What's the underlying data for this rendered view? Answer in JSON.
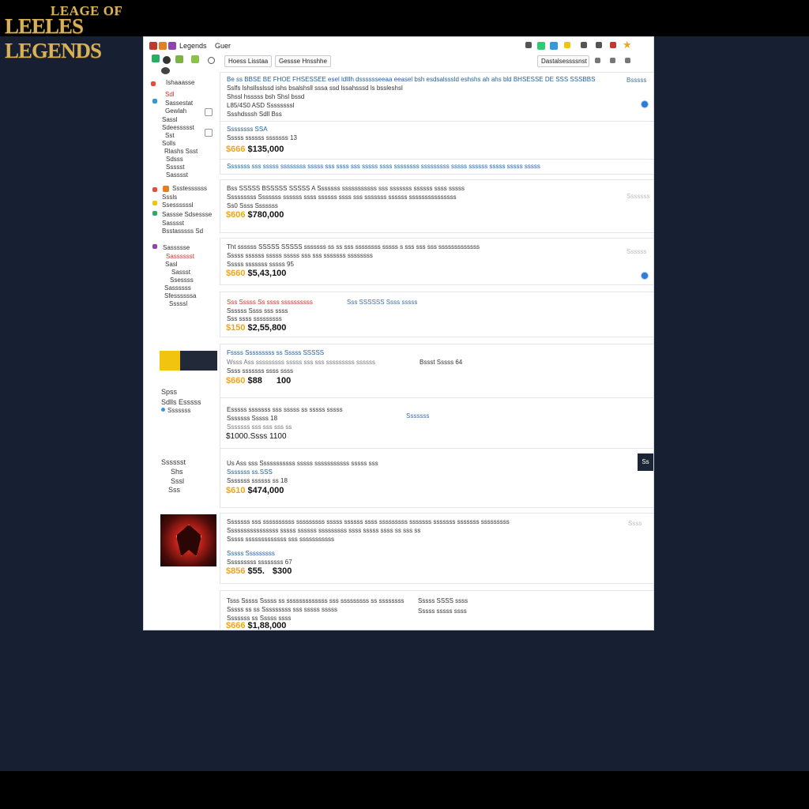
{
  "logo": {
    "line1": "LEAGE OF",
    "line2": "LEELES LEGENDS"
  },
  "toolbar": {
    "title_left": "Legends",
    "title_mid": "Guer",
    "btn_primary": "Hoess Lisstaa",
    "btn_secondary": "Gessse Hnsshhe",
    "dropdown": "Dastalsessssnst"
  },
  "sidebar": {
    "section1": [
      "Ishaaasse",
      "Sdl",
      "Sassestat",
      "Gewlah",
      "Sassl",
      "Sdeessssst",
      "Sst",
      "Solls",
      "Rlashs Ssst",
      "Sdsss",
      "Ssssst",
      "Sasssst"
    ],
    "section2": [
      "Ssstessssss",
      "Sssls",
      "Ssessssssl",
      "Sassse Sdsessse",
      "Sasssst",
      "Bsstasssss Sd"
    ],
    "section3": [
      "Sassssse",
      "Sasssssst",
      "Sasl",
      "Sassst",
      "Ssessss",
      "Sassssss",
      "Sfessssssa",
      "Sssssl"
    ],
    "section4_label1": "Spss",
    "section4_label2": "Sdlls Esssss",
    "section4_label3": "Sssssss",
    "section5_label1": "Sssssst",
    "section5_label2": "Shs",
    "section5_label3": "Sssl",
    "section5_label4": "Sss"
  },
  "listings": [
    {
      "line1": "Be ss BBSE BE FHOE FHSESSEE esel ldlllh dsssssseeaa eeasel bsh esdsalsssld eshshs ah ahs bld BHSESSE DE SSS SSSBBS",
      "line2": "Sslfs lshsllsslssd ishs bsalshsll sssa ssd lssahsssd ls bssleshsl",
      "line3": "Shssl hsssss bsh Shsl bssd",
      "line4": "L85/4S0 ASD Ssssssssl",
      "line5": "Ssshdsssh Sdll Bss",
      "right": "Bsssss"
    },
    {
      "line1": "Ssssssss SSA",
      "line2": "Sssss ssssss sssssss 13",
      "price_tag": "$666",
      "price": "$135,000"
    },
    {
      "line1": "Sssssss sss sssss ssssssss sssss sss ssss sss sssss ssss ssssssss sssssssss sssss ssssss sssss sssss sssss"
    },
    {
      "line1": "Bss SSSSS BSSSSS SSSSS A Sssssss sssssssssss sss sssssss ssssss ssss sssss",
      "line2": "Sssssssss Sssssss ssssss ssss ssssss ssss sss sssssss ssssss sssssssssssssss",
      "line3": "Ss0 Ssss Sssssss",
      "price_tag": "$606",
      "price": "$780,000",
      "right": "Sssssss"
    },
    {
      "line1": "Tht ssssss SSSSS SSSSS sssssss ss ss sss ssssssss sssss s sss sss sss sssssssssssss",
      "line2": "Sssss ssssss sssss sssss sss sss sssssss ssssssss",
      "line3": "Sssss sssssss sssss 95",
      "price_tag": "$660",
      "price": "$5,43,100",
      "right": "Ssssss"
    },
    {
      "line1": "Sss Sssss Ss ssss ssssssssss",
      "line1b": "Sss SSSSSS Ssss sssss",
      "line2": "Ssssss Ssss sss ssss",
      "line3": "Sss ssss sssssssss",
      "price_tag": "$150",
      "price": "$2,55,800"
    },
    {
      "line1": "Fssss Sssssssss ss Sssss SSSSS",
      "line2": "Wsss Ass sssssssss sssss sss sss sssssssss ssssss",
      "line3": "Ssss sssssss ssss ssss",
      "price_tag": "$660",
      "price": "$88",
      "price2": "100",
      "right_label": "Bssst Sssss 64"
    },
    {
      "line1": "Esssss sssssss sss sssss ss sssss sssss",
      "line2": "Sssssss Sssss 18",
      "line3": "Sssssss sss sss sss ss",
      "price": "$1000.Ssss  1100",
      "right": "Sssssss"
    },
    {
      "line1": "Us Ass sss Sssssssssss sssss sssssssssss sssss sss",
      "line2": "Sssssss ss.SSS",
      "line3": "Sssssss ssssss ss 18",
      "price_tag": "$610",
      "price": "$474,000",
      "dark_tab": "Ss"
    },
    {
      "line1": "Sssssss sss ssssssssss sssssssss sssss ssssss ssss sssssssss sssssss sssssss sssssss sssssssss",
      "line2": "Ssssssssssssssss sssss ssssss sssssssss ssss sssss ssss ss sss ss",
      "line3": "Sssss sssssssssssss sss sssssssssss",
      "line4": "Sssss Sssssssss",
      "line5": "Sssssssss ssssssss 67",
      "price_tag": "$856",
      "price": "$55.",
      "price2": "$300",
      "right": "Ssss"
    },
    {
      "line1": "Tsss Sssss Sssss ss sssssssssssss sss sssssssss ss ssssssss",
      "line2": "Sssss ss ss Sssssssss sss sssss sssss",
      "line3": "Sssssss ss Sssss ssss",
      "price_tag": "$666",
      "price": "$1,88,000",
      "right_a": "Sssss SSSS ssss",
      "right_b": "Sssss sssss ssss"
    }
  ],
  "colors": {
    "accent_gold": "#f0a41b",
    "link_blue": "#1f5e9c",
    "background": "#172033"
  }
}
